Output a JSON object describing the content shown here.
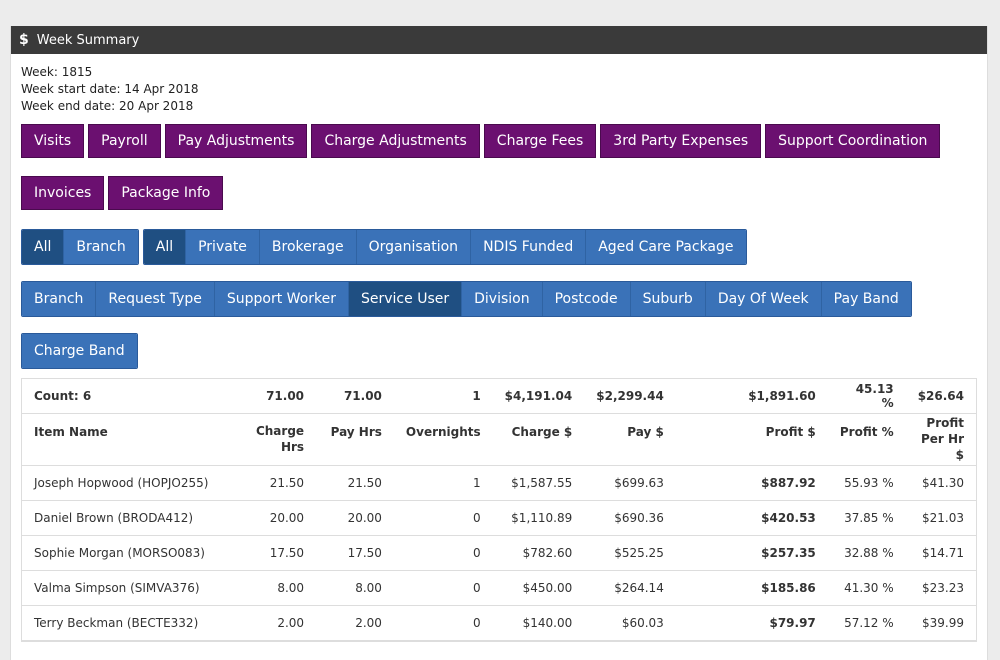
{
  "panel": {
    "title": "Week Summary",
    "icon": "dollar-icon"
  },
  "meta": {
    "week": "Week: 1815",
    "start": "Week start date: 14 Apr 2018",
    "end": "Week end date: 20 Apr 2018"
  },
  "tabs": [
    "Visits",
    "Payroll",
    "Pay Adjustments",
    "Charge Adjustments",
    "Charge Fees",
    "3rd Party Expenses",
    "Support Coordination",
    "Invoices",
    "Package Info"
  ],
  "filter1": [
    "All",
    "Branch"
  ],
  "filter2": [
    "All",
    "Private",
    "Brokerage",
    "Organisation",
    "NDIS Funded",
    "Aged Care Package"
  ],
  "groupby": [
    "Branch",
    "Request Type",
    "Support Worker",
    "Service User",
    "Division",
    "Postcode",
    "Suburb",
    "Day Of Week",
    "Pay Band",
    "Charge Band"
  ],
  "summary": {
    "count": "Count: 6",
    "charge_hrs": "71.00",
    "pay_hrs": "71.00",
    "overnights": "1",
    "charge": "$4,191.04",
    "pay": "$2,299.44",
    "profit": "$1,891.60",
    "profit_pct": "45.13 %",
    "profit_per_hr": "$26.64"
  },
  "columns": {
    "item": "Item Name",
    "charge_hrs_1": "Charge",
    "charge_hrs_2": "Hrs",
    "pay_hrs": "Pay Hrs",
    "overnights": "Overnights",
    "charge": "Charge $",
    "pay": "Pay $",
    "profit": "Profit $",
    "profit_pct": "Profit %",
    "pph_1": "Profit",
    "pph_2": "Per Hr $"
  },
  "rows": [
    {
      "name": "Joseph Hopwood (HOPJO255)",
      "charge_hrs": "21.50",
      "pay_hrs": "21.50",
      "overnights": "1",
      "charge": "$1,587.55",
      "pay": "$699.63",
      "profit": "$887.92",
      "profit_pct": "55.93 %",
      "pph": "$41.30"
    },
    {
      "name": "Daniel Brown (BRODA412)",
      "charge_hrs": "20.00",
      "pay_hrs": "20.00",
      "overnights": "0",
      "charge": "$1,110.89",
      "pay": "$690.36",
      "profit": "$420.53",
      "profit_pct": "37.85 %",
      "pph": "$21.03"
    },
    {
      "name": "Sophie Morgan (MORSO083)",
      "charge_hrs": "17.50",
      "pay_hrs": "17.50",
      "overnights": "0",
      "charge": "$782.60",
      "pay": "$525.25",
      "profit": "$257.35",
      "profit_pct": "32.88 %",
      "pph": "$14.71"
    },
    {
      "name": "Valma Simpson (SIMVA376)",
      "charge_hrs": "8.00",
      "pay_hrs": "8.00",
      "overnights": "0",
      "charge": "$450.00",
      "pay": "$264.14",
      "profit": "$185.86",
      "profit_pct": "41.30 %",
      "pph": "$23.23"
    },
    {
      "name": "Terry Beckman (BECTE332)",
      "charge_hrs": "2.00",
      "pay_hrs": "2.00",
      "overnights": "0",
      "charge": "$140.00",
      "pay": "$60.03",
      "profit": "$79.97",
      "profit_pct": "57.12 %",
      "pph": "$39.99"
    }
  ]
}
